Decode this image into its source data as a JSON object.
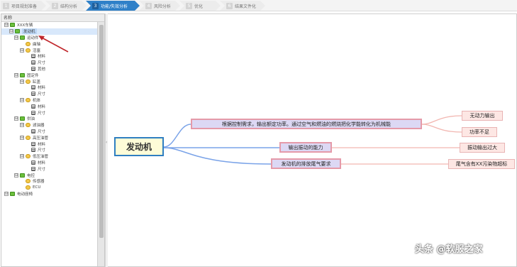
{
  "stepbar": {
    "steps": [
      {
        "num": "1",
        "label": "项目规划准备",
        "active": false
      },
      {
        "num": "2",
        "label": "结构分析",
        "active": false
      },
      {
        "num": "3",
        "label": "功能/失效分析",
        "active": true
      },
      {
        "num": "4",
        "label": "风险分析",
        "active": false
      },
      {
        "num": "5",
        "label": "优化",
        "active": false
      },
      {
        "num": "6",
        "label": "结果文件化",
        "active": false
      }
    ]
  },
  "tree": {
    "header": "名称",
    "rows": [
      {
        "label": "XXX车辆",
        "icon": "system-icon",
        "toggle": "⊟"
      },
      {
        "label": "发动机",
        "icon": "system-icon",
        "toggle": "⊟",
        "selected": true
      },
      {
        "label": "运动件",
        "icon": "system-icon",
        "toggle": "⊟"
      },
      {
        "label": "曲轴",
        "icon": "function-icon",
        "toggle": ""
      },
      {
        "label": "活塞",
        "icon": "function-icon",
        "toggle": "⊟"
      },
      {
        "label": "材料",
        "icon": "attribute-icon",
        "toggle": ""
      },
      {
        "label": "尺寸",
        "icon": "attribute-icon",
        "toggle": ""
      },
      {
        "label": "其他",
        "icon": "attribute-icon",
        "toggle": ""
      },
      {
        "label": "固定件",
        "icon": "system-icon",
        "toggle": "⊟"
      },
      {
        "label": "缸盖",
        "icon": "function-icon",
        "toggle": "⊟"
      },
      {
        "label": "材料",
        "icon": "attribute-icon",
        "toggle": ""
      },
      {
        "label": "尺寸",
        "icon": "attribute-icon",
        "toggle": ""
      },
      {
        "label": "机体",
        "icon": "function-icon",
        "toggle": "⊟"
      },
      {
        "label": "材料",
        "icon": "attribute-icon",
        "toggle": ""
      },
      {
        "label": "尺寸",
        "icon": "attribute-icon",
        "toggle": ""
      },
      {
        "label": "供油",
        "icon": "system-icon",
        "toggle": "⊟"
      },
      {
        "label": "滤油器",
        "icon": "function-icon",
        "toggle": "⊟"
      },
      {
        "label": "尺寸",
        "icon": "attribute-icon",
        "toggle": ""
      },
      {
        "label": "高压油管",
        "icon": "function-icon",
        "toggle": "⊟"
      },
      {
        "label": "材料",
        "icon": "attribute-icon",
        "toggle": ""
      },
      {
        "label": "尺寸",
        "icon": "attribute-icon",
        "toggle": ""
      },
      {
        "label": "低压油管",
        "icon": "function-icon",
        "toggle": "⊟"
      },
      {
        "label": "材料",
        "icon": "attribute-icon",
        "toggle": ""
      },
      {
        "label": "尺寸",
        "icon": "attribute-icon",
        "toggle": ""
      },
      {
        "label": "电控",
        "icon": "system-icon",
        "toggle": "⊟"
      },
      {
        "label": "传感器",
        "icon": "function-icon",
        "toggle": ""
      },
      {
        "label": "ECU",
        "icon": "function-icon",
        "toggle": ""
      },
      {
        "label": "电动座椅",
        "icon": "system-icon",
        "toggle": "⊟"
      }
    ]
  },
  "mindmap": {
    "root": "发动机",
    "functions": [
      {
        "label": "根据控制需求，输出额定功率。通过空气和燃油的燃烧把化学能转化为机械能",
        "failures": [
          "无动力输出",
          "功率不足"
        ]
      },
      {
        "label": "输出振动的能力",
        "failures": [
          "振动输出过大"
        ]
      },
      {
        "label": "发动机的排放尾气要求",
        "failures": [
          "尾气含有XX污染物超标"
        ]
      }
    ]
  },
  "watermark": "头条 @软服之家",
  "colors": {
    "active_step": "#2f80c8",
    "root_border": "#2f7fc1",
    "link_blue": "#7aa3e8",
    "link_pink": "#f2b6b0",
    "mid_fill": "#dcd8f4",
    "leaf_fill": "#fde7e4"
  }
}
